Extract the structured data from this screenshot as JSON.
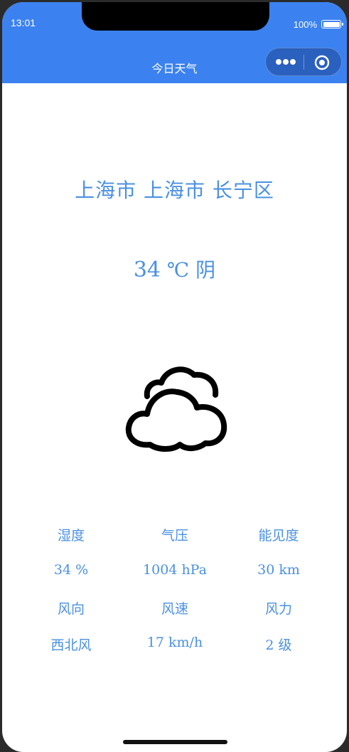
{
  "status_bar": {
    "time": "13:01",
    "battery": "100%"
  },
  "nav": {
    "title": "今日天气",
    "more_icon": "more-dots-icon",
    "close_icon": "target-circle-icon"
  },
  "weather": {
    "location": "上海市 上海市 长宁区",
    "temperature": "34",
    "unit_condition": "℃ 阴",
    "condition_icon": "cloudy-icon",
    "details": [
      {
        "label": "湿度",
        "value": "34 %"
      },
      {
        "label": "气压",
        "value": "1004 hPa"
      },
      {
        "label": "能见度",
        "value": "30 km"
      },
      {
        "label": "风向",
        "value": "西北风"
      },
      {
        "label": "风速",
        "value": "17 km/h"
      },
      {
        "label": "风力",
        "value": "2 级"
      }
    ]
  },
  "colors": {
    "header_bg": "#3b82f0",
    "accent_text": "#4a90e2"
  }
}
